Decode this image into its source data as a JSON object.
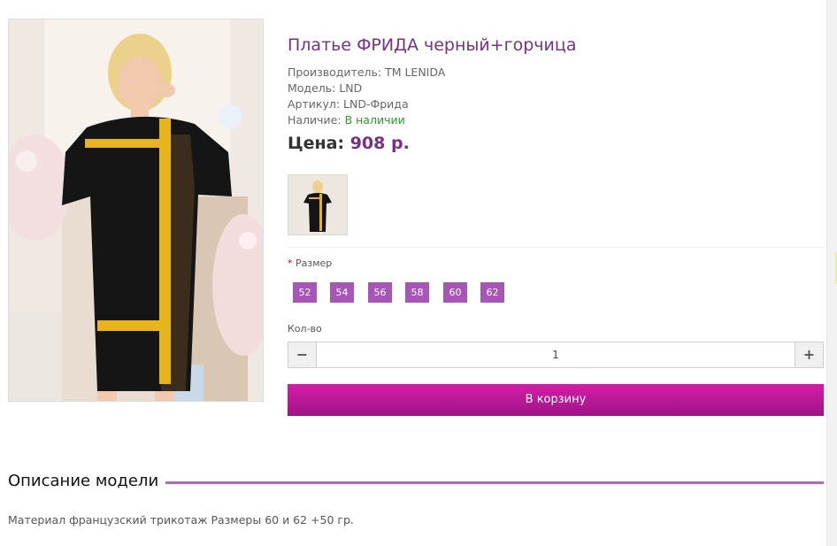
{
  "product": {
    "title": "Платье ФРИДА черный+горчица",
    "manufacturer_label": "Производитель:",
    "manufacturer": "ТМ LENIDA",
    "model_label": "Модель:",
    "model": "LND",
    "sku_label": "Артикул:",
    "sku": "LND-Фрида",
    "availability_label": "Наличие:",
    "availability": "В наличии",
    "price_label": "Цена:",
    "price": "908 р."
  },
  "options": {
    "size_required_mark": "*",
    "size_label": "Размер",
    "sizes": [
      "52",
      "54",
      "56",
      "58",
      "60",
      "62"
    ]
  },
  "quantity": {
    "label": "Кол-во",
    "minus": "−",
    "value": "1",
    "plus": "+"
  },
  "cart_button": "В корзину",
  "description": {
    "title": "Описание модели",
    "text": "Материал французский трикотаж Размеры 60 и 62 +50 гр."
  },
  "colors": {
    "accent": "#7a2f86",
    "size_bg": "#a855b8",
    "cart_bg": "#c0199b",
    "available": "#2a9a2a"
  }
}
